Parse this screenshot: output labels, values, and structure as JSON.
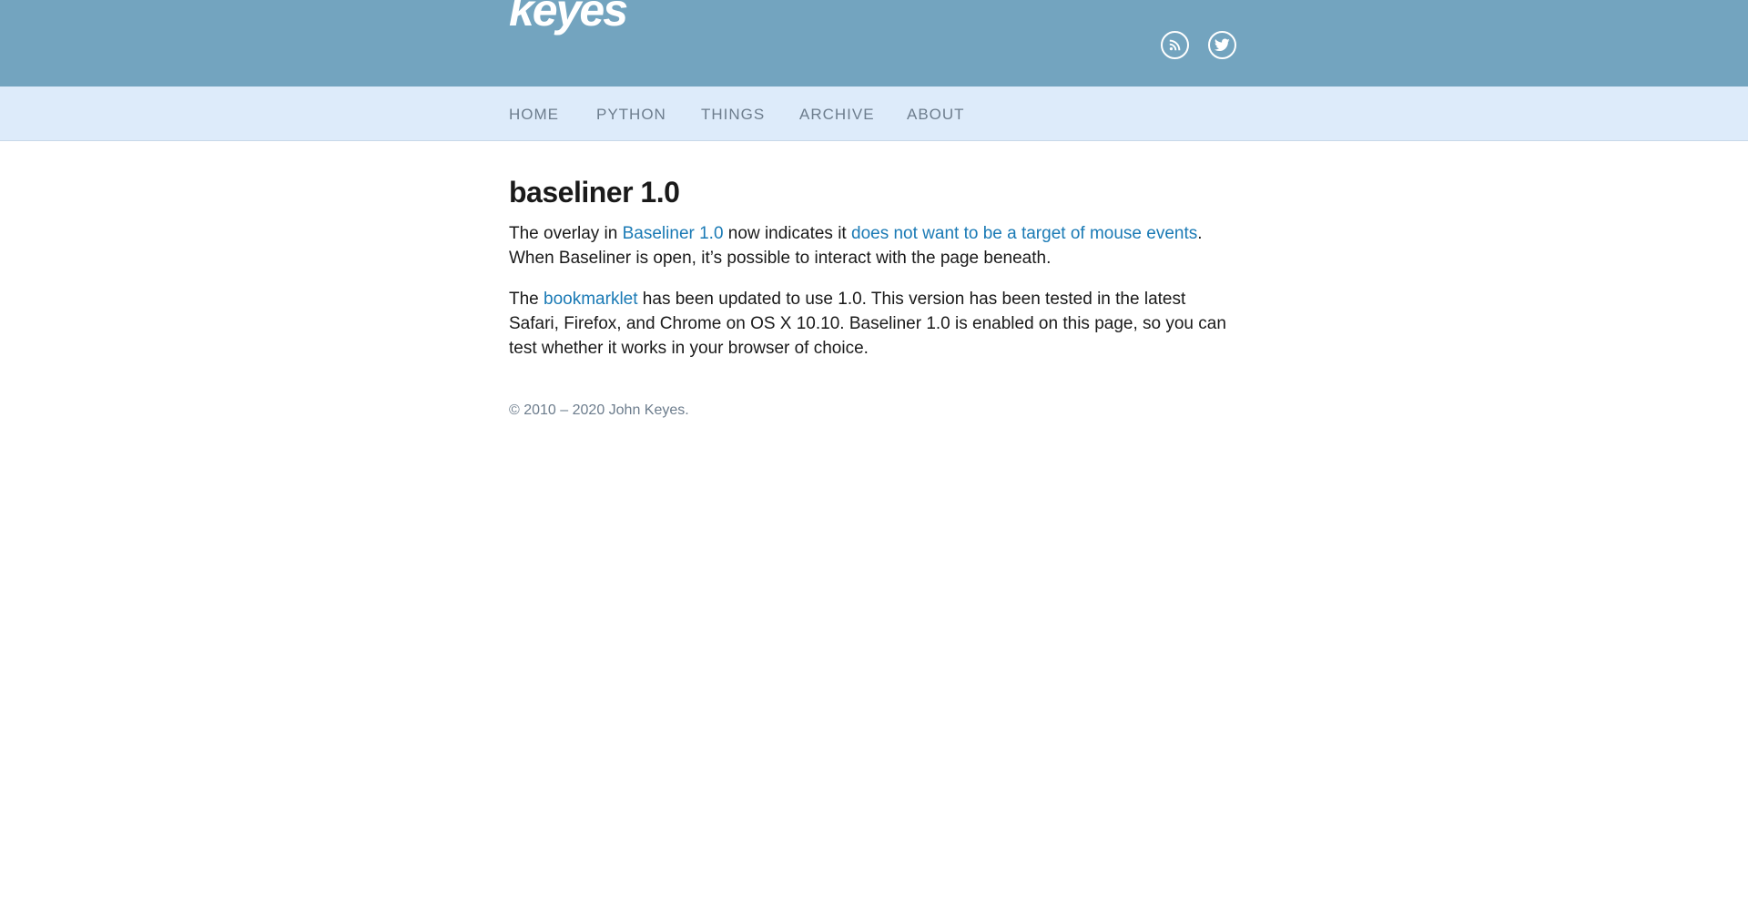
{
  "header": {
    "logo": "keyes",
    "icons": [
      "rss-icon",
      "twitter-icon"
    ],
    "background_color": "#73a4bf"
  },
  "nav": {
    "items": [
      {
        "label": "HOME"
      },
      {
        "label": "PYTHON"
      },
      {
        "label": "THINGS"
      },
      {
        "label": "ARCHIVE"
      },
      {
        "label": "ABOUT"
      }
    ],
    "background_color": "#ddebfa"
  },
  "article": {
    "title": "baseliner 1.0",
    "p1": {
      "t1": "The overlay in ",
      "link1": "Baseliner 1.0",
      "t2": " now indicates it ",
      "link2": "does not want to be a target of mouse events",
      "t3": ".",
      "t4": "When Baseliner is open, it’s possible to interact with the page beneath."
    },
    "p2": {
      "t1": "The ",
      "link1": "bookmarklet",
      "t2": " has been updated to use 1.0. This version has been tested in the latest Safari, Firefox, and Chrome on OS X 10.10. Baseliner 1.0 is enabled on this page, so you can test whether it works in your browser of choice."
    },
    "link_color": "#1a7ab5"
  },
  "footer": {
    "copyright": "© 2010 – 2020 John Keyes."
  }
}
